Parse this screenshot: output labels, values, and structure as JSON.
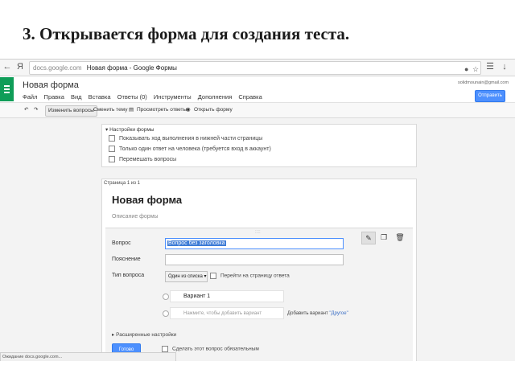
{
  "slide": {
    "title": "3. Открывается форма для создания теста."
  },
  "browser": {
    "url_host": "docs.google.com",
    "tab_title": "Новая форма - Google Формы",
    "back": "←",
    "forward": "→",
    "reload": "C",
    "yandex": "Я"
  },
  "docs": {
    "title": "Новая форма",
    "menu": [
      "Файл",
      "Правка",
      "Вид",
      "Вставка",
      "Ответы (0)",
      "Инструменты",
      "Дополнения",
      "Справка"
    ],
    "user_email": "solidmounain@gmail.com",
    "send_label": "Отправить"
  },
  "toolbar": {
    "edit_questions": "Изменить вопросы",
    "change_theme": "Сменить тему",
    "view_answers": "Просмотреть ответы",
    "view_form": "Открыть форму"
  },
  "settings": {
    "header": "Настройки формы",
    "options": [
      "Показывать ход выполнения в нижней части страницы",
      "Только один ответ на человека (требуется вход в аккаунт)",
      "Перемешать вопросы"
    ]
  },
  "form": {
    "page_label": "Страница 1 из 1",
    "title": "Новая форма",
    "description_placeholder": "Описание формы",
    "question_label": "Вопрос",
    "question_value": "Вопрос без заголовка",
    "hint_label": "Пояснение",
    "type_label": "Тип вопроса",
    "type_value": "Один из списка",
    "goto_label": "Перейти на страницу ответа",
    "option1": "Вариант 1",
    "option_add_placeholder": "Нажмите, чтобы добавить вариант",
    "add_other_prefix": "Добавить вариант",
    "add_other_link": "\"Другое\"",
    "advanced": "Расширенные настройки",
    "done_label": "Готово",
    "required_label": "Сделать этот вопрос обязательным"
  },
  "status_bar": "Ожидание docs.google.com..."
}
